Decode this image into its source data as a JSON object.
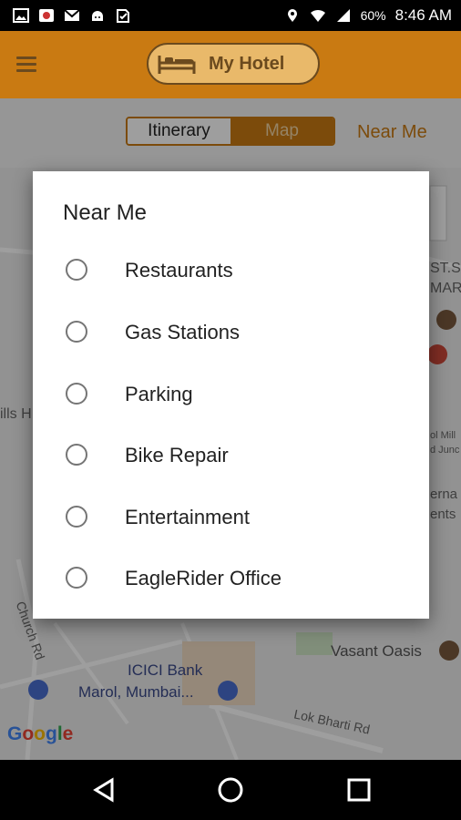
{
  "status_bar": {
    "battery": "60%",
    "time": "8:46 AM"
  },
  "app_bar": {
    "title": "My Hotel"
  },
  "tabs": {
    "itinerary": "Itinerary",
    "map": "Map",
    "near_me": "Near Me",
    "selected": "Map"
  },
  "map": {
    "labels": [
      "ICICI Bank",
      "Marol, Mumbai...",
      "Vasant Oasis",
      "Lok Bharti Rd",
      "Church Rd",
      "ills H",
      "ST.S",
      "MAR",
      "ol Mill",
      "d Junc",
      "erna",
      "ents"
    ],
    "logo": "Google"
  },
  "dialog": {
    "title": "Near Me",
    "options": [
      "Restaurants",
      "Gas Stations",
      "Parking",
      "Bike Repair",
      "Entertainment",
      "EagleRider Office"
    ]
  }
}
